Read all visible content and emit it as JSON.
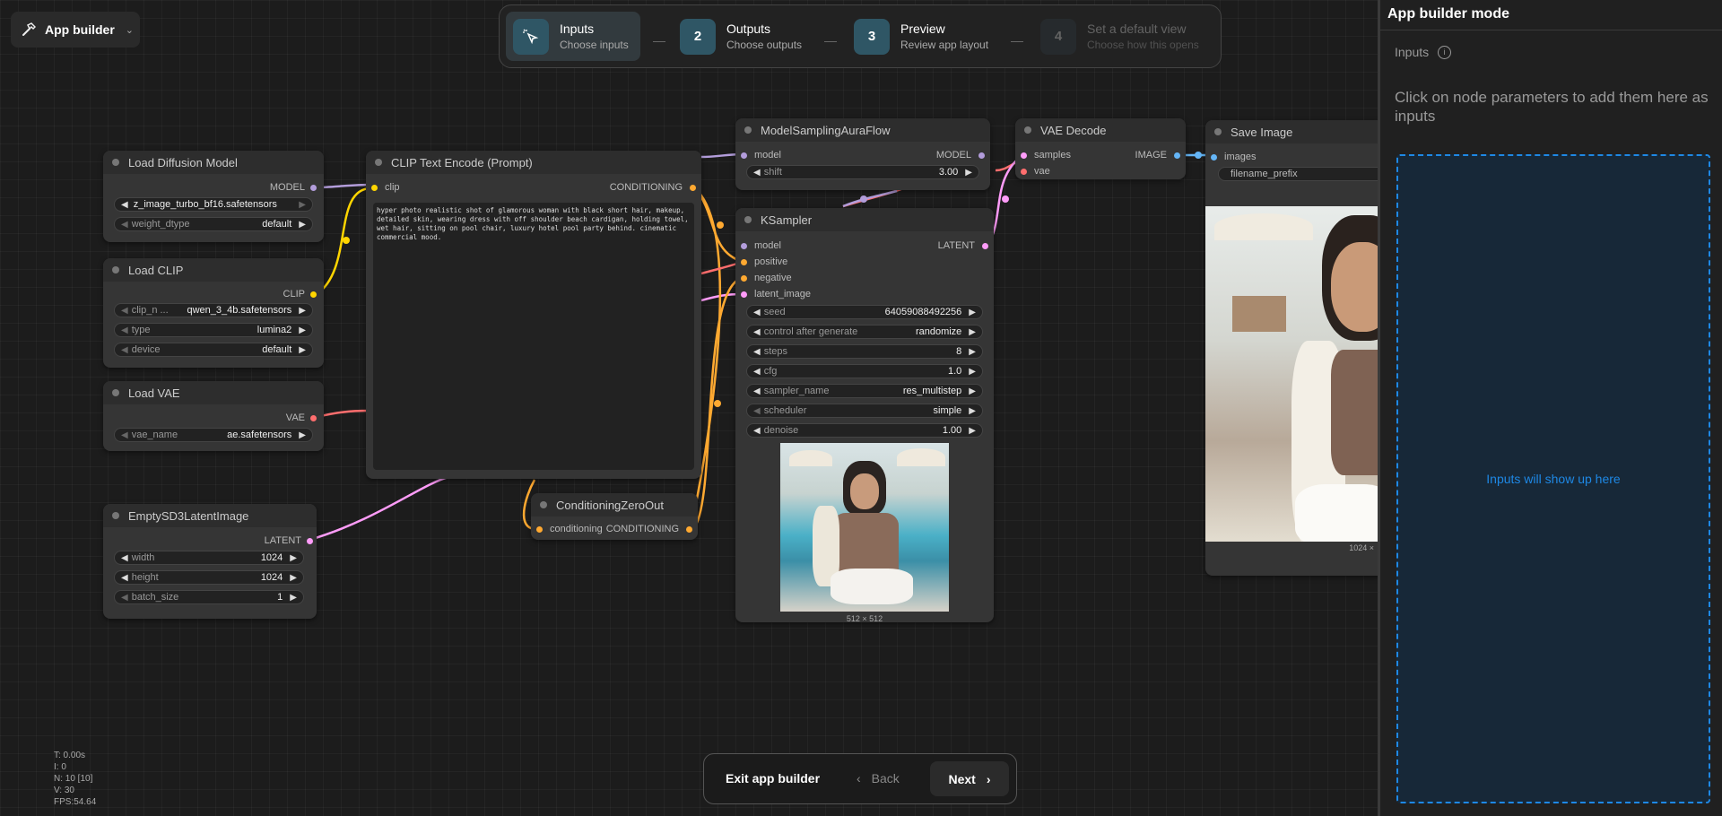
{
  "app_menu": {
    "label": "App builder"
  },
  "steps": [
    {
      "num": "",
      "title": "Inputs",
      "subtitle": "Choose inputs"
    },
    {
      "num": "2",
      "title": "Outputs",
      "subtitle": "Choose outputs"
    },
    {
      "num": "3",
      "title": "Preview",
      "subtitle": "Review app layout"
    },
    {
      "num": "4",
      "title": "Set a default view",
      "subtitle": "Choose how this opens"
    }
  ],
  "nodes": {
    "load_diffusion": {
      "title": "Load Diffusion Model",
      "out": "MODEL",
      "unet": "z_image_turbo_bf16.safetensors",
      "dtype_label": "weight_dtype",
      "dtype": "default"
    },
    "load_clip": {
      "title": "Load CLIP",
      "out": "CLIP",
      "clip_label": "clip_n ...",
      "clip": "qwen_3_4b.safetensors",
      "type_label": "type",
      "type": "lumina2",
      "device_label": "device",
      "device": "default"
    },
    "load_vae": {
      "title": "Load VAE",
      "out": "VAE",
      "vae_label": "vae_name",
      "vae": "ae.safetensors"
    },
    "empty_latent": {
      "title": "EmptySD3LatentImage",
      "out": "LATENT",
      "width_label": "width",
      "width": "1024",
      "height_label": "height",
      "height": "1024",
      "batch_label": "batch_size",
      "batch": "1"
    },
    "clip_encode": {
      "title": "CLIP Text Encode (Prompt)",
      "in": "clip",
      "out": "CONDITIONING",
      "text": "hyper photo realistic shot of glamorous woman with black short hair, makeup, detailed skin, wearing dress with off shoulder beach cardigan, holding towel, wet hair, sitting on pool chair, luxury hotel pool party behind. cinematic commercial mood."
    },
    "cond_zero": {
      "title": "ConditioningZeroOut",
      "in": "conditioning",
      "out": "CONDITIONING"
    },
    "model_sampling": {
      "title": "ModelSamplingAuraFlow",
      "in": "model",
      "out": "MODEL",
      "shift_label": "shift",
      "shift": "3.00"
    },
    "ksampler": {
      "title": "KSampler",
      "in_model": "model",
      "in_pos": "positive",
      "in_neg": "negative",
      "in_latent": "latent_image",
      "out": "LATENT",
      "seed_label": "seed",
      "seed": "64059088492256",
      "cag_label": "control after generate",
      "cag": "randomize",
      "steps_label": "steps",
      "steps": "8",
      "cfg_label": "cfg",
      "cfg": "1.0",
      "sampler_label": "sampler_name",
      "sampler": "res_multistep",
      "sched_label": "scheduler",
      "sched": "simple",
      "denoise_label": "denoise",
      "denoise": "1.00",
      "preview_size": "512 × 512"
    },
    "vae_decode": {
      "title": "VAE Decode",
      "in_samples": "samples",
      "in_vae": "vae",
      "out": "IMAGE"
    },
    "save_image": {
      "title": "Save Image",
      "in": "images",
      "prefix_label": "filename_prefix",
      "size": "1024 ×"
    }
  },
  "panel": {
    "title": "App builder mode",
    "section": "Inputs",
    "hint": "Click on node parameters to add them here as inputs",
    "placeholder": "Inputs will show up here"
  },
  "bottom": {
    "exit": "Exit app builder",
    "back": "Back",
    "next": "Next"
  },
  "stats": {
    "t": "T: 0.00s",
    "i": "I: 0",
    "n": "N: 10 [10]",
    "v": "V: 30",
    "fps": "FPS:54.64"
  },
  "colors": {
    "model": "#b39ddb",
    "clip": "#ffd500",
    "vae": "#ff6e6e",
    "latent": "#ff9cf9",
    "conditioning": "#ffa931",
    "image": "#64b5f6",
    "accent": "#2f5665",
    "panel_accent": "#1e88e5"
  }
}
